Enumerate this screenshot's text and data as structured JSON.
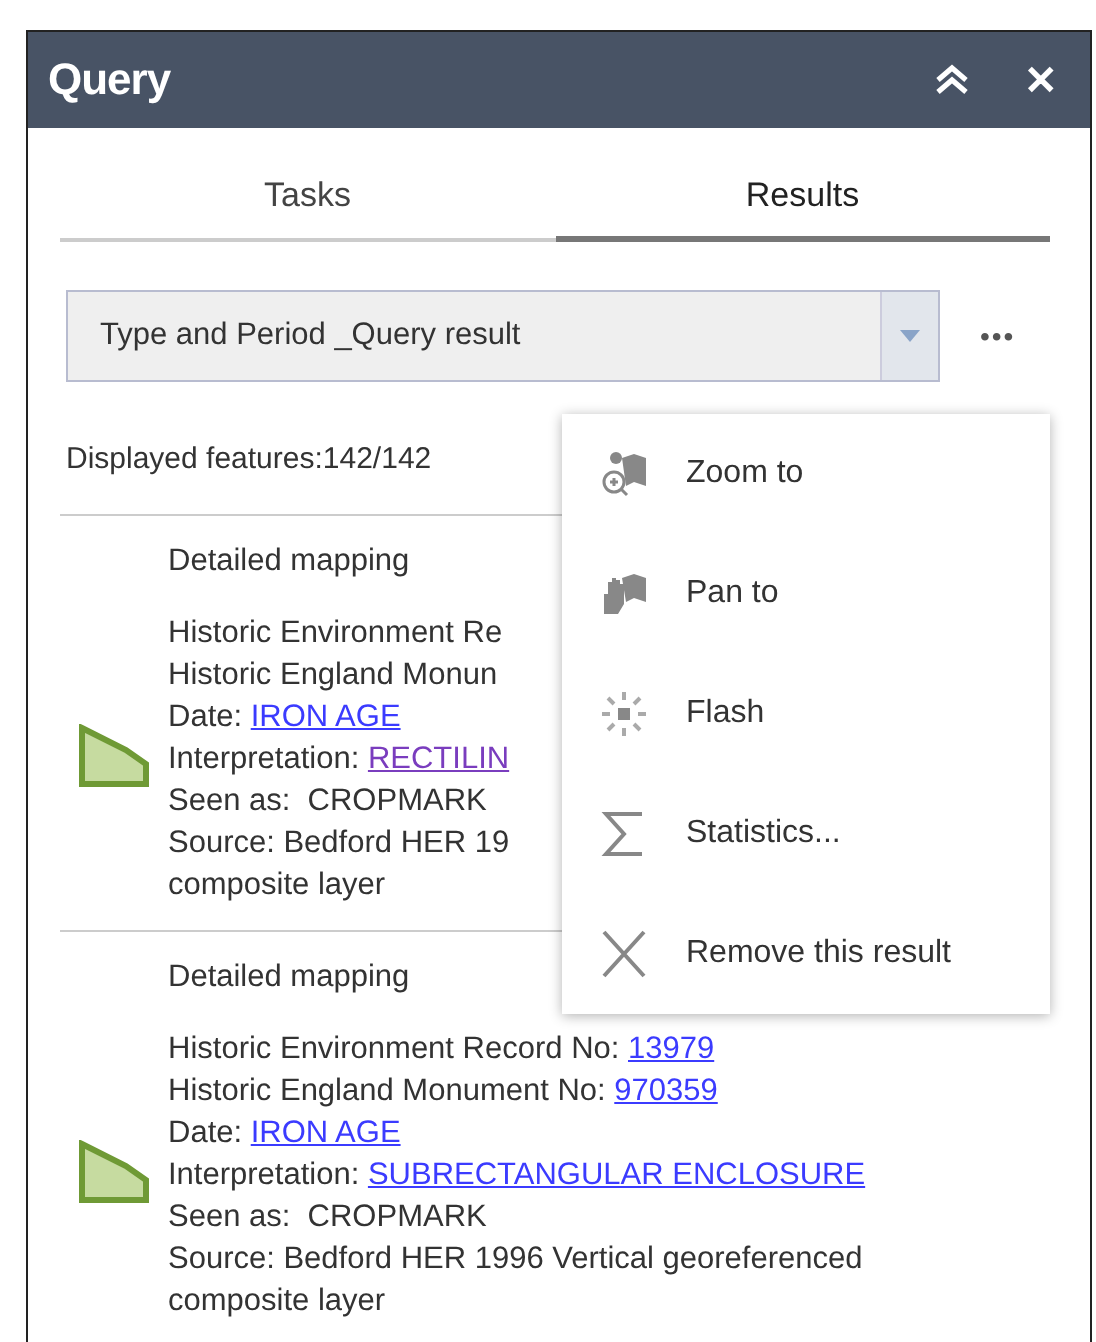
{
  "window": {
    "title": "Query",
    "close_icon": "✕"
  },
  "tabs": [
    {
      "label": "Tasks",
      "selected": false
    },
    {
      "label": "Results",
      "selected": true
    }
  ],
  "result_select": {
    "value": "Type and Period _Query result"
  },
  "more_icon": "•••",
  "displayed": "Displayed features:142/142",
  "results": [
    {
      "title": "Detailed mapping",
      "lines": [
        {
          "label": "Historic Environment Re"
        },
        {
          "label": "Historic England Monun"
        },
        {
          "label": "Date:",
          "value": "IRON AGE",
          "kind": "link",
          "visited": false
        },
        {
          "label": "Interpretation:",
          "value": "RECTILIN",
          "kind": "link",
          "visited": true
        },
        {
          "label": "Seen as:",
          "value": "CROPMARK",
          "kind": "text"
        },
        {
          "label": "Source:",
          "value": "Bedford HER 19",
          "kind": "text"
        },
        {
          "value": "composite layer",
          "kind": "text"
        }
      ]
    },
    {
      "title": "Detailed mapping",
      "lines": [
        {
          "label": "Historic Environment Record No:",
          "value": "13979",
          "kind": "link",
          "visited": false
        },
        {
          "label": "Historic England Monument No:",
          "value": "970359",
          "kind": "link",
          "visited": false
        },
        {
          "label": "Date:",
          "value": "IRON AGE",
          "kind": "link",
          "visited": false
        },
        {
          "label": "Interpretation:",
          "value": "SUBRECTANGULAR ENCLOSURE",
          "kind": "link",
          "visited": false
        },
        {
          "label": "Seen as:",
          "value": "CROPMARK",
          "kind": "text"
        },
        {
          "label": "Source:",
          "value": "Bedford HER 1996 Vertical georeferenced",
          "kind": "text"
        },
        {
          "value": "composite layer",
          "kind": "text"
        }
      ]
    }
  ],
  "menu": [
    {
      "label": "Zoom to",
      "kind": "zoom"
    },
    {
      "label": "Pan to",
      "kind": "pan"
    },
    {
      "label": "Flash",
      "kind": "flash"
    },
    {
      "label": "Statistics...",
      "kind": "stats"
    },
    {
      "label": "Remove this result",
      "kind": "remove"
    }
  ]
}
